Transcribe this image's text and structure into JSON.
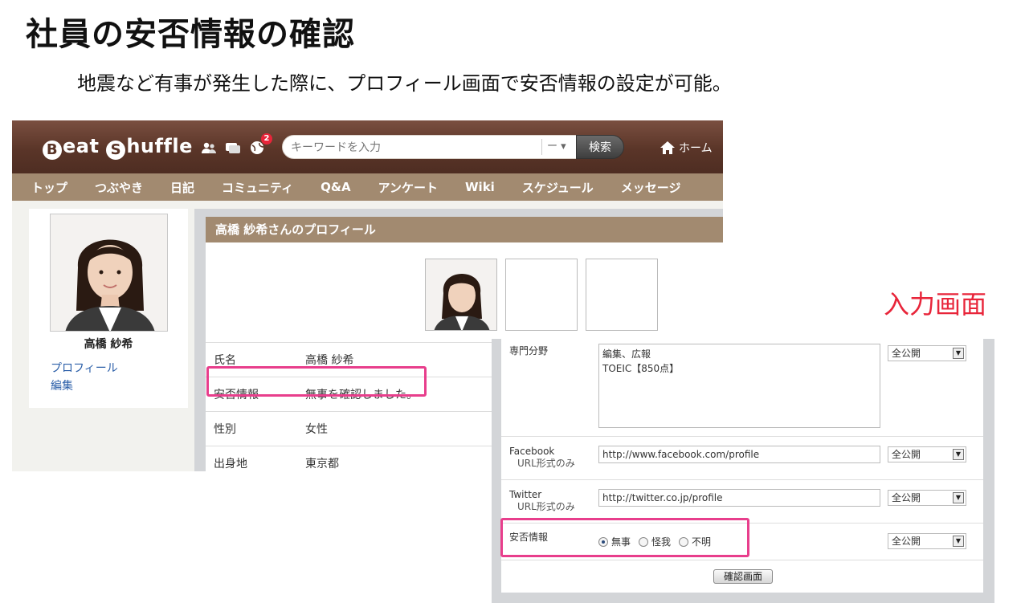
{
  "slide": {
    "title": "社員の安否情報の確認",
    "subtitle": "地震など有事が発生した際に、プロフィール画面で安否情報の設定が可能。",
    "input_screen_label": "入力画面"
  },
  "app": {
    "logo_b": "B",
    "logo_eat": "eat ",
    "logo_s": "S",
    "logo_huffle": "huffle",
    "notification_count": "2",
    "search_placeholder": "キーワードを入力",
    "search_scope": "ー ▾",
    "search_button": "検索",
    "home_label": "ホーム"
  },
  "nav": [
    "トップ",
    "つぶやき",
    "日記",
    "コミュニティ",
    "Q&A",
    "アンケート",
    "Wiki",
    "スケジュール",
    "メッセージ"
  ],
  "sidebar": {
    "user_name": "高橋 紗希",
    "links": [
      "プロフィール",
      "編集"
    ]
  },
  "profile": {
    "header": "高橋 紗希さんのプロフィール",
    "rows": [
      {
        "key": "氏名",
        "value": "高橋 紗希"
      },
      {
        "key": "安否情報",
        "value": "無事を確認しました。"
      },
      {
        "key": "性別",
        "value": "女性"
      },
      {
        "key": "出身地",
        "value": "東京都"
      }
    ]
  },
  "form": {
    "specialty_label": "専門分野",
    "specialty_value_line1": "編集、広報",
    "specialty_value_line2": "TOEIC【850点】",
    "facebook_label": "Facebook",
    "facebook_sub": "URL形式のみ",
    "facebook_value": "http://www.facebook.com/profile",
    "twitter_label": "Twitter",
    "twitter_sub": "URL形式のみ",
    "twitter_value": "http://twitter.co.jp/profile",
    "safety_label": "安否情報",
    "safety_options": [
      "無事",
      "怪我",
      "不明"
    ],
    "safety_selected": "無事",
    "visibility": "全公開",
    "confirm_button": "確認画面"
  },
  "colors": {
    "header_brown": "#5a3528",
    "nav_tan": "#a28a70",
    "highlight_pink": "#e83e8c",
    "label_red": "#e8253a",
    "link_blue": "#2a5ea8"
  }
}
